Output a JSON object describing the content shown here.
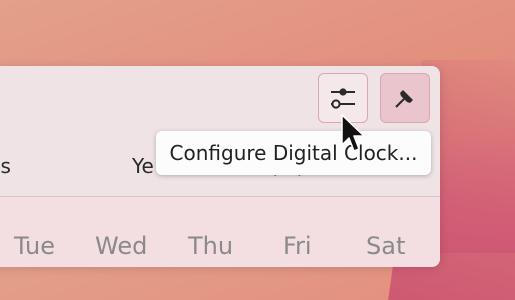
{
  "header": {
    "configure_icon": "sliders-icon",
    "pin_icon": "pin-icon"
  },
  "view_tabs": {
    "months": "ths",
    "years": "Ye",
    "partial": "(   .    )"
  },
  "weekdays": [
    "Tue",
    "Wed",
    "Thu",
    "Fri",
    "Sat"
  ],
  "tooltip": {
    "text": "Configure Digital Clock..."
  },
  "colors": {
    "popup_bg": "#efe3e5",
    "accent_border": "#d9a7b1",
    "pin_active_bg": "#ebc5cd"
  }
}
